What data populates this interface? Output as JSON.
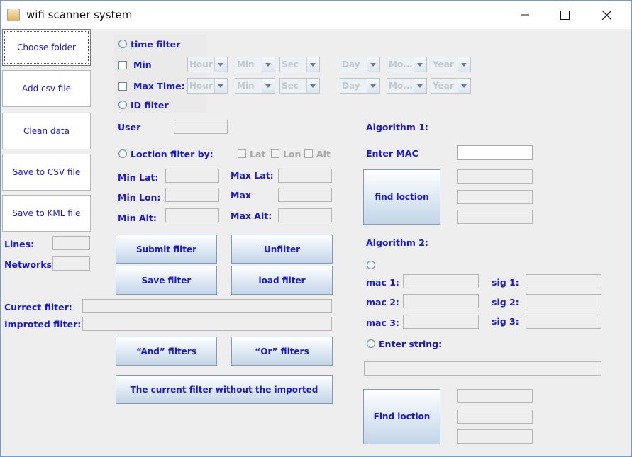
{
  "window": {
    "title": "wifi scanner system",
    "minimize_glyph": "—",
    "maximize_glyph": "☐",
    "close_glyph": "✕"
  },
  "sidebar": {
    "choose_folder": "Choose folder",
    "add_csv": "Add csv file",
    "clean_data": "Clean data",
    "save_csv": "Save to CSV file",
    "save_kml": "Save to KML file",
    "lines_label": "Lines:",
    "lines_value": "",
    "networks_label": "Networks:",
    "networks_value": ""
  },
  "filters": {
    "time_filter": "time filter",
    "min_label": "Min",
    "max_time_label": "Max Time:",
    "combo_hour": "Hour",
    "combo_min": "Min",
    "combo_sec": "Sec",
    "combo_day": "Day",
    "combo_month": "Mo...",
    "combo_year": "Year",
    "id_filter": "ID filter",
    "user_label": "User",
    "user_value": "",
    "location_filter": "Loction filter by:",
    "lat": "Lat",
    "lon": "Lon",
    "alt": "Alt",
    "min_lat": "Min Lat:",
    "max_lat": "Max Lat:",
    "min_lon": "Min Lon:",
    "max_lon": "Max",
    "min_alt": "Min Alt:",
    "max_alt": "Max Alt:",
    "submit": "Submit filter",
    "unfilter": "Unfilter",
    "save": "Save filter",
    "load": "load filter",
    "current_label": "Currect filter:",
    "current_value": "",
    "imported_label": "Improted filter:",
    "imported_value": "",
    "and_filters": "“And” filters",
    "or_filters": "“Or” filters",
    "current_without_imported": "The current filter without the imported"
  },
  "algorithm1": {
    "title": "Algorithm 1:",
    "enter_mac": "Enter MAC",
    "mac_value": "",
    "find_button": "find loction"
  },
  "algorithm2": {
    "title": "Algorithm 2:",
    "mac1": "mac 1:",
    "mac2": "mac 2:",
    "mac3": "mac 3:",
    "sig1": "sig 1:",
    "sig2": "sig 2:",
    "sig3": "sig 3:",
    "enter_string": "Enter string:",
    "string_value": "",
    "find_button": "Find loction"
  }
}
